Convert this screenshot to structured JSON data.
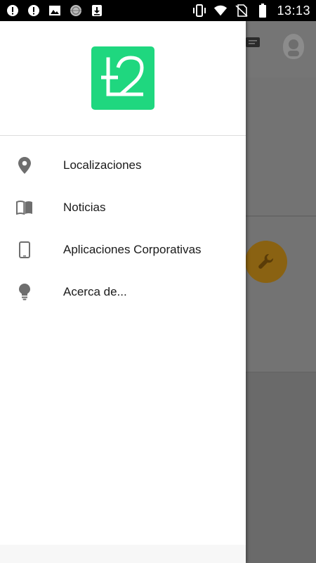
{
  "status_bar": {
    "time": "13:13",
    "left_icons": [
      "alert-icon",
      "alert-icon",
      "image-icon",
      "globe-icon",
      "download-icon"
    ],
    "right_icons": [
      "vibrate-icon",
      "wifi-icon",
      "no-sim-icon",
      "battery-icon"
    ]
  },
  "logo": {
    "text": "t2",
    "color": "#1fd77f"
  },
  "drawer": {
    "items": [
      {
        "label": "Localizaciones",
        "icon": "location-pin-icon"
      },
      {
        "label": "Noticias",
        "icon": "book-icon"
      },
      {
        "label": "Aplicaciones Corporativas",
        "icon": "smartphone-icon"
      },
      {
        "label": "Acerca de...",
        "icon": "lightbulb-icon"
      }
    ]
  },
  "background": {
    "fab_icon": "wrench-icon",
    "fab_color": "#8a6212"
  }
}
